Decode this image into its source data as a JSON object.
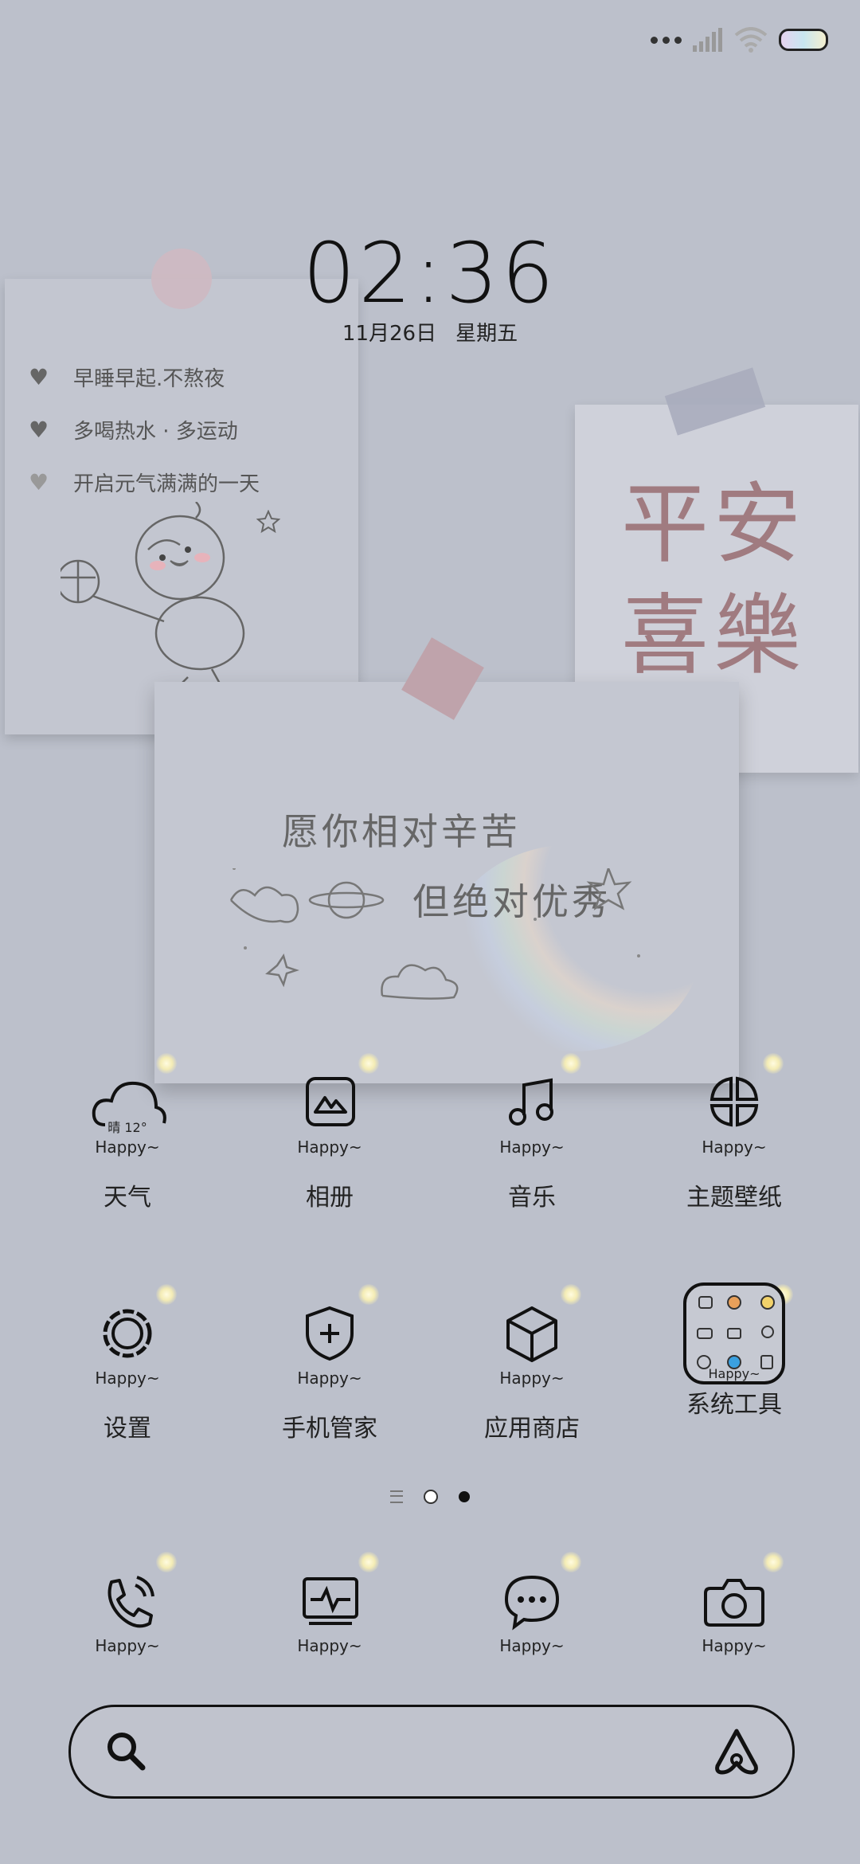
{
  "status_bar": {
    "icons": [
      "more-dots-icon",
      "signal-icon",
      "wifi-icon",
      "battery-icon"
    ]
  },
  "clock": {
    "time": "02:36",
    "date": "11月26日",
    "weekday": "星期五"
  },
  "widget": {
    "notes": [
      "早睡早起.不熬夜",
      "多喝热水 · 多运动",
      "开启元气满满的一天"
    ],
    "blessing_line1": "平安",
    "blessing_line2": "喜樂",
    "quote_line1": "愿你相对辛苦",
    "quote_line2": "但绝对优秀"
  },
  "apps_row1": [
    {
      "label": "天气",
      "icon": "weather-icon",
      "badge": "Happy~",
      "weather_text": "晴 12°"
    },
    {
      "label": "相册",
      "icon": "gallery-icon",
      "badge": "Happy~"
    },
    {
      "label": "音乐",
      "icon": "music-icon",
      "badge": "Happy~"
    },
    {
      "label": "主题壁纸",
      "icon": "themes-icon",
      "badge": "Happy~"
    }
  ],
  "apps_row2": [
    {
      "label": "设置",
      "icon": "settings-icon",
      "badge": "Happy~"
    },
    {
      "label": "手机管家",
      "icon": "security-icon",
      "badge": "Happy~"
    },
    {
      "label": "应用商店",
      "icon": "app-store-icon",
      "badge": "Happy~"
    },
    {
      "label": "系统工具",
      "icon": "system-tools-folder-icon",
      "badge": "Happy~"
    }
  ],
  "dock": [
    {
      "icon": "phone-icon",
      "badge": "Happy~"
    },
    {
      "icon": "monitor-icon",
      "badge": "Happy~"
    },
    {
      "icon": "messages-icon",
      "badge": "Happy~"
    },
    {
      "icon": "camera-icon",
      "badge": "Happy~"
    }
  ],
  "pager": {
    "current_page": 2,
    "total_pages": 2
  },
  "search_bar": {
    "left_icon": "search-icon",
    "right_icon": "assistant-icon"
  }
}
